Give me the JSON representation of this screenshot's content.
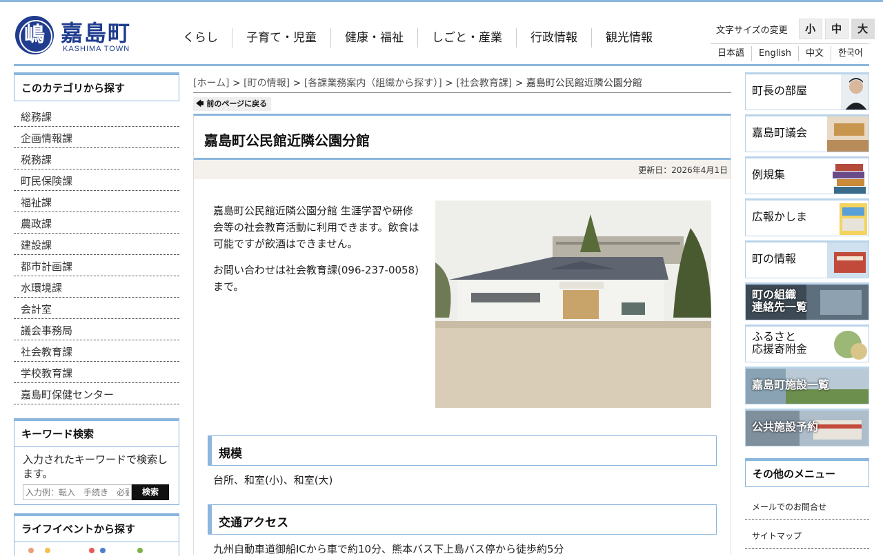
{
  "header": {
    "logo_text": "嘉島町",
    "logo_sub": "KASHIMA TOWN",
    "logo_mark": "嶋",
    "nav": [
      "くらし",
      "子育て・児童",
      "健康・福祉",
      "しごと・産業",
      "行政情報",
      "観光情報"
    ],
    "fontsize_label": "文字サイズの変更",
    "fontsize_buttons": [
      "小",
      "中",
      "大"
    ],
    "languages": [
      "日本語",
      "English",
      "中文",
      "한국어"
    ]
  },
  "left": {
    "category_title": "このカテゴリから探す",
    "categories": [
      "総務課",
      "企画情報課",
      "税務課",
      "町民保険課",
      "福祉課",
      "農政課",
      "建設課",
      "都市計画課",
      "水環境課",
      "会計室",
      "議会事務局",
      "社会教育課",
      "学校教育課",
      "嘉島町保健センター"
    ],
    "keyword_title": "キーワード検索",
    "keyword_desc": "入力されたキーワードで検索します。",
    "keyword_placeholder": "入力例：転入　手続き　必要書類",
    "keyword_button": "検索",
    "life_title": "ライフイベントから探す"
  },
  "breadcrumb": {
    "items": [
      "[ホーム]",
      "[町の情報]",
      "[各課業務案内（組織から探す）]",
      "[社会教育課]"
    ],
    "separator": ">",
    "current": "嘉島町公民館近隣公園分館"
  },
  "back_button": "前のページに戻る",
  "article": {
    "title": "嘉島町公民館近隣公園分館",
    "updated": "更新日：2026年4月1日",
    "intro1": "嘉島町公民館近隣公園分館 生涯学習や研修会等の社会教育活動に利用できます。飲食は可能ですが飲酒はできません。",
    "intro2": "お問い合わせは社会教育課(096-237-0058)まで。",
    "section1_title": "規模",
    "section1_text": "台所、和室(小)、和室(大)",
    "section2_title": "交通アクセス",
    "section2_text": "九州自動車道御船ICから車で約10分、熊本バス下上島バス停から徒歩約5分"
  },
  "right": {
    "banners": [
      "町長の部屋",
      "嘉島町議会",
      "例規集",
      "広報かしま",
      "町の情報",
      "町の組織\n連絡先一覧",
      "ふるさと\n応援寄附金",
      "嘉島町施設一覧",
      "公共施設予約"
    ],
    "other_title": "その他のメニュー",
    "other_items": [
      "メールでのお問合せ",
      "サイトマップ"
    ]
  }
}
